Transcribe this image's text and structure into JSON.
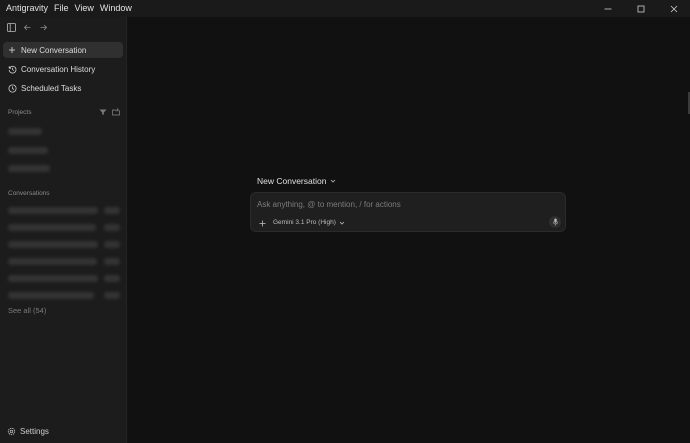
{
  "menu": {
    "items": [
      "Antigravity",
      "File",
      "View",
      "Window"
    ]
  },
  "sidebar": {
    "nav": [
      {
        "label": "New Conversation",
        "icon": "plus-icon",
        "active": true
      },
      {
        "label": "Conversation History",
        "icon": "history-icon"
      },
      {
        "label": "Scheduled Tasks",
        "icon": "clock-icon"
      }
    ],
    "projects_label": "Projects",
    "conversations_label": "Conversations",
    "see_all": "See all (54)",
    "settings": "Settings"
  },
  "main": {
    "title": "New Conversation",
    "input": {
      "placeholder": "Ask anything, @ to mention, / for actions",
      "value": ""
    },
    "model": "Gemini 3.1 Pro (High)"
  },
  "colors": {
    "background": "#111111",
    "sidebar": "#1c1c1c",
    "active_item": "#303030",
    "input_box": "#1f1f1f"
  }
}
